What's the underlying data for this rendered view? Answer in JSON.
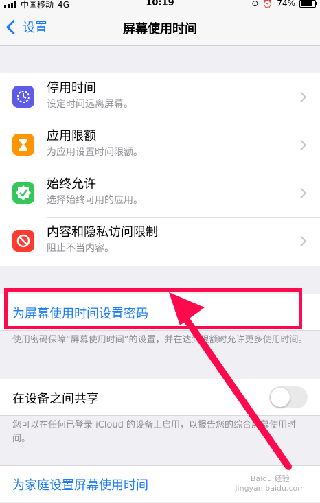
{
  "status_bar": {
    "carrier": "中国移动",
    "network": "4G",
    "time": "10:19",
    "battery": "74%"
  },
  "nav": {
    "back_label": "设置",
    "title": "屏幕使用时间"
  },
  "features": [
    {
      "title": "停用时间",
      "subtitle": "设定时间远离屏幕。",
      "icon": "downtime-icon",
      "color": "#5e5ce6"
    },
    {
      "title": "应用限额",
      "subtitle": "为应用设置时间限额。",
      "icon": "hourglass-icon",
      "color": "#ff9500"
    },
    {
      "title": "始终允许",
      "subtitle": "选择始终可用的应用。",
      "icon": "checkmark-badge-icon",
      "color": "#34c759"
    },
    {
      "title": "内容和隐私访问限制",
      "subtitle": "阻止不当内容。",
      "icon": "restriction-icon",
      "color": "#ff3b30"
    }
  ],
  "passcode": {
    "label": "为屏幕使用时间设置密码",
    "note": "使用密码保障“屏幕使用时间”的设置，并在达到限额时允许更多使用时间。"
  },
  "share": {
    "label": "在设备之间共享",
    "enabled": false,
    "note": "您可以在任何已登录 iCloud 的设备上启用，以报告您的综合屏幕使用时间。"
  },
  "family": {
    "label": "为家庭设置屏幕使用时间"
  },
  "watermark": {
    "line1": "Baidu 经验",
    "line2": "jingyan.baidu.com"
  },
  "colors": {
    "accent": "#1a7cf8",
    "annotation": "#ff0a4c"
  }
}
